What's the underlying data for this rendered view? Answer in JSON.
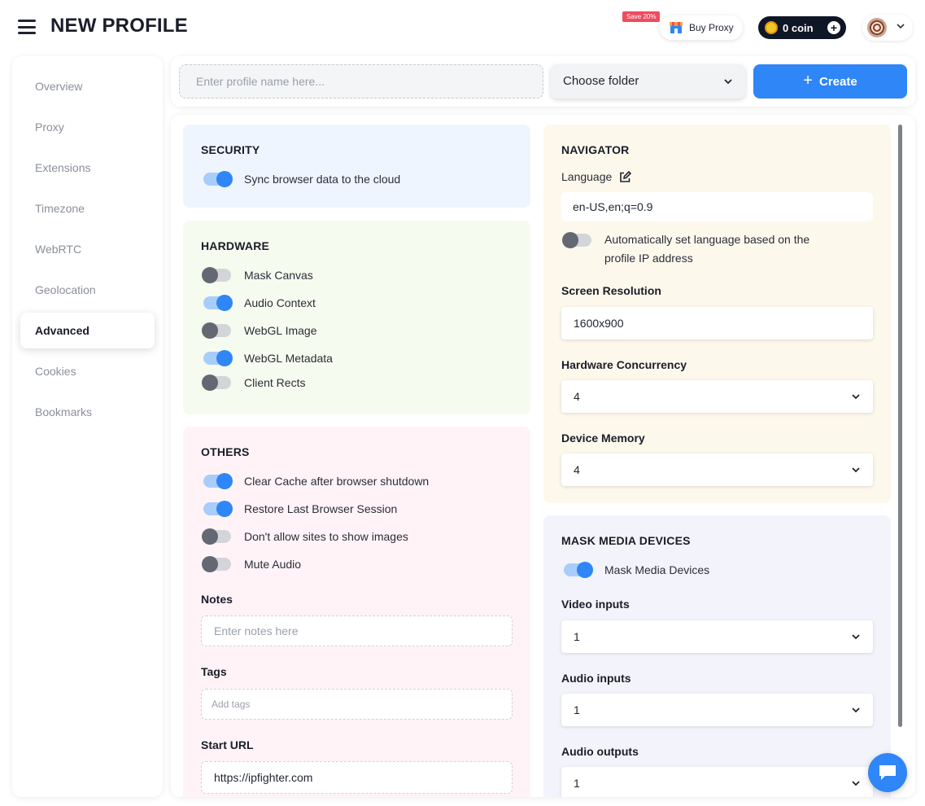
{
  "header": {
    "title": "NEW PROFILE",
    "save_badge": "Save 20%",
    "buy_proxy": "Buy Proxy",
    "coin_label": "0 coin"
  },
  "sidebar": {
    "items": [
      {
        "label": "Overview",
        "active": false
      },
      {
        "label": "Proxy",
        "active": false
      },
      {
        "label": "Extensions",
        "active": false
      },
      {
        "label": "Timezone",
        "active": false
      },
      {
        "label": "WebRTC",
        "active": false
      },
      {
        "label": "Geolocation",
        "active": false
      },
      {
        "label": "Advanced",
        "active": true
      },
      {
        "label": "Cookies",
        "active": false
      },
      {
        "label": "Bookmarks",
        "active": false
      }
    ]
  },
  "topbar": {
    "name_placeholder": "Enter profile name here...",
    "folder_label": "Choose folder",
    "create_label": "Create"
  },
  "security": {
    "title": "SECURITY",
    "sync_label": "Sync browser data to the cloud",
    "sync_on": true
  },
  "hardware": {
    "title": "HARDWARE",
    "items": [
      {
        "label": "Mask Canvas",
        "on": false
      },
      {
        "label": "Audio Context",
        "on": true
      },
      {
        "label": "WebGL Image",
        "on": false
      },
      {
        "label": "WebGL Metadata",
        "on": true
      },
      {
        "label": "Client Rects",
        "on": false
      }
    ]
  },
  "others": {
    "title": "OTHERS",
    "items": [
      {
        "label": "Clear Cache after browser shutdown",
        "on": true
      },
      {
        "label": "Restore Last Browser Session",
        "on": true
      },
      {
        "label": "Don't allow sites to show images",
        "on": false
      },
      {
        "label": "Mute Audio",
        "on": false
      }
    ],
    "notes_label": "Notes",
    "notes_placeholder": "Enter notes here",
    "tags_label": "Tags",
    "tags_placeholder": "Add tags",
    "start_url_label": "Start URL",
    "start_url_value": "https://ipfighter.com"
  },
  "navigator": {
    "title": "NAVIGATOR",
    "language_label": "Language",
    "language_value": "en-US,en;q=0.9",
    "auto_lang_line1": "Automatically set language based on the",
    "auto_lang_line2": "profile IP address",
    "auto_lang_on": false,
    "screen_res_label": "Screen Resolution",
    "screen_res_value": "1600x900",
    "hw_concurrency_label": "Hardware Concurrency",
    "hw_concurrency_value": "4",
    "device_memory_label": "Device Memory",
    "device_memory_value": "4"
  },
  "media": {
    "title": "MASK MEDIA DEVICES",
    "mask_label": "Mask Media Devices",
    "mask_on": true,
    "video_label": "Video inputs",
    "video_value": "1",
    "audio_in_label": "Audio inputs",
    "audio_in_value": "1",
    "audio_out_label": "Audio outputs",
    "audio_out_value": "1"
  },
  "colors": {
    "accent": "#2f86f6",
    "security_bg": "#eef5fe",
    "hardware_bg": "#f6fbef",
    "others_bg": "#fff3f7",
    "navigator_bg": "#fdf8ec",
    "media_bg": "#f3f3fb"
  }
}
